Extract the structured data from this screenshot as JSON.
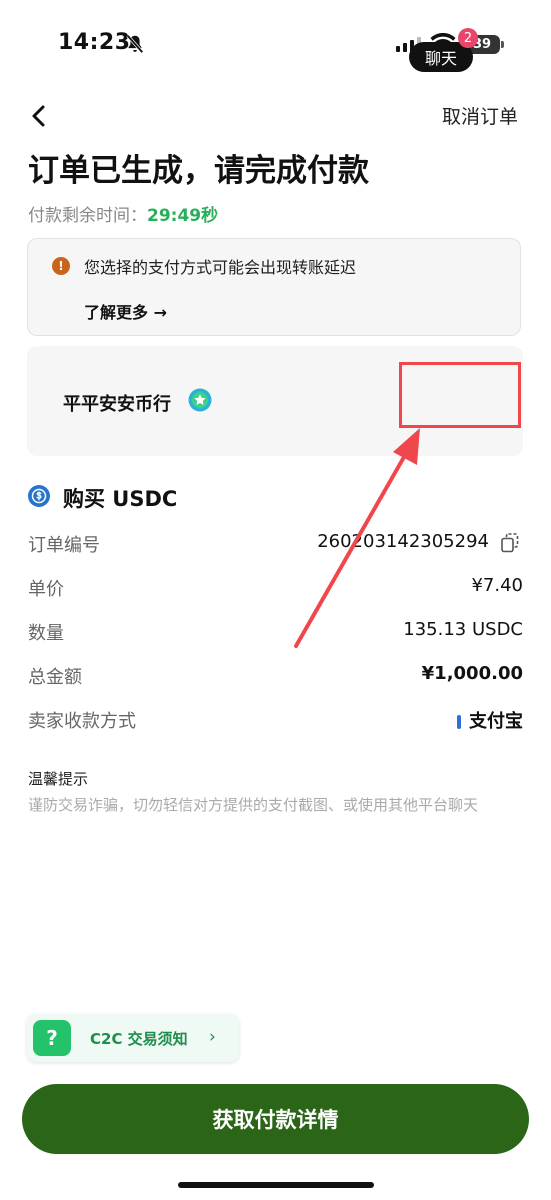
{
  "status_bar": {
    "time": "14:23",
    "battery": "39"
  },
  "nav": {
    "cancel_label": "取消订单"
  },
  "header": {
    "title": "订单已生成，请完成付款",
    "timer_label": "付款剩余时间：",
    "timer_value": "29:49秒"
  },
  "notice": {
    "text": "您选择的支付方式可能会出现转账延迟",
    "link_label": "了解更多 →",
    "icon": "!"
  },
  "merchant": {
    "name": "平平安安币行",
    "chat_label": "聊天",
    "unread_count": "2"
  },
  "order": {
    "title": "购买 USDC",
    "rows": [
      {
        "label": "订单编号",
        "value": "260203142305294"
      },
      {
        "label": "单价",
        "value": "¥7.40"
      },
      {
        "label": "数量",
        "value": "135.13 USDC"
      },
      {
        "label": "总金额",
        "value": "¥1,000.00"
      },
      {
        "label": "卖家收款方式",
        "value": "支付宝"
      }
    ]
  },
  "tips": {
    "title": "温馨提示",
    "text": "谨防交易诈骗，切勿轻信对方提供的支付截图、或使用其他平台聊天"
  },
  "c2c": {
    "icon": "?",
    "label": "C2C 交易须知",
    "chevron": "›"
  },
  "primary_button": {
    "label": "获取付款详情"
  },
  "colors": {
    "accent_green": "#27b05a",
    "primary_button": "#2b6517",
    "highlight_red": "#f0474c",
    "payment_blue": "#2f6fd8"
  }
}
